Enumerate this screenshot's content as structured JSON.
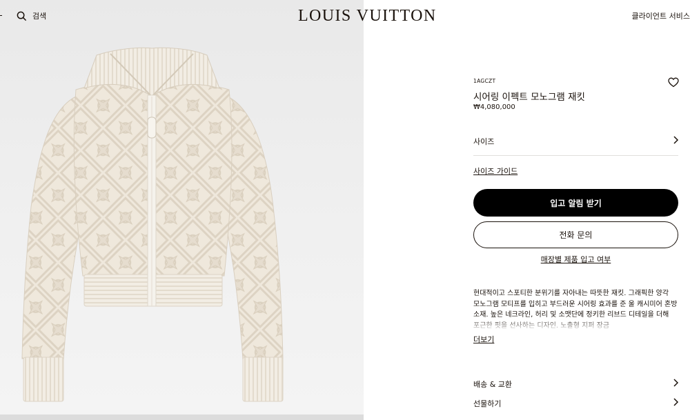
{
  "header": {
    "search_label": "검색",
    "logo": "LOUIS VUITTON",
    "client_service": "클라이언트 서비스"
  },
  "product": {
    "sku": "1AGCZT",
    "name": "시어링 이펙트 모노그램 재킷",
    "price": "₩4,080,000",
    "image_alt": "cream knit zip-up jacket with monogram pattern"
  },
  "actions": {
    "size_label": "사이즈",
    "size_guide_label": "사이즈 가이드",
    "notify_label": "입고 알림 받기",
    "phone_label": "전화 문의",
    "store_stock_label": "매장별 제품 입고 여부"
  },
  "description": {
    "text": "현대적이고 스포티한 분위기를 자아내는 따뜻한 재킷. 그래픽한 양각 모노그램 모티프를 입히고 부드러운 시어링 효과를 준 울 캐시미어 혼방 소재. 높은 네크라인, 허리 및 소맷단에 정키한 리브드 디테일을 더해 포근한 핏을 선사하는 디자인. 노출형 지퍼 장금",
    "more_label": "더보기"
  },
  "info_links": [
    {
      "label": "배송 & 교환"
    },
    {
      "label": "선물하기"
    }
  ],
  "colors": {
    "primary_button_bg": "#000000",
    "text": "#19110b",
    "divider": "#e1dfdc",
    "image_bg": "#eeeeee",
    "jacket": "#efe8dc"
  },
  "icons": {
    "search": "search-icon",
    "wishlist": "heart-icon",
    "chevron": "chevron-right-icon"
  }
}
